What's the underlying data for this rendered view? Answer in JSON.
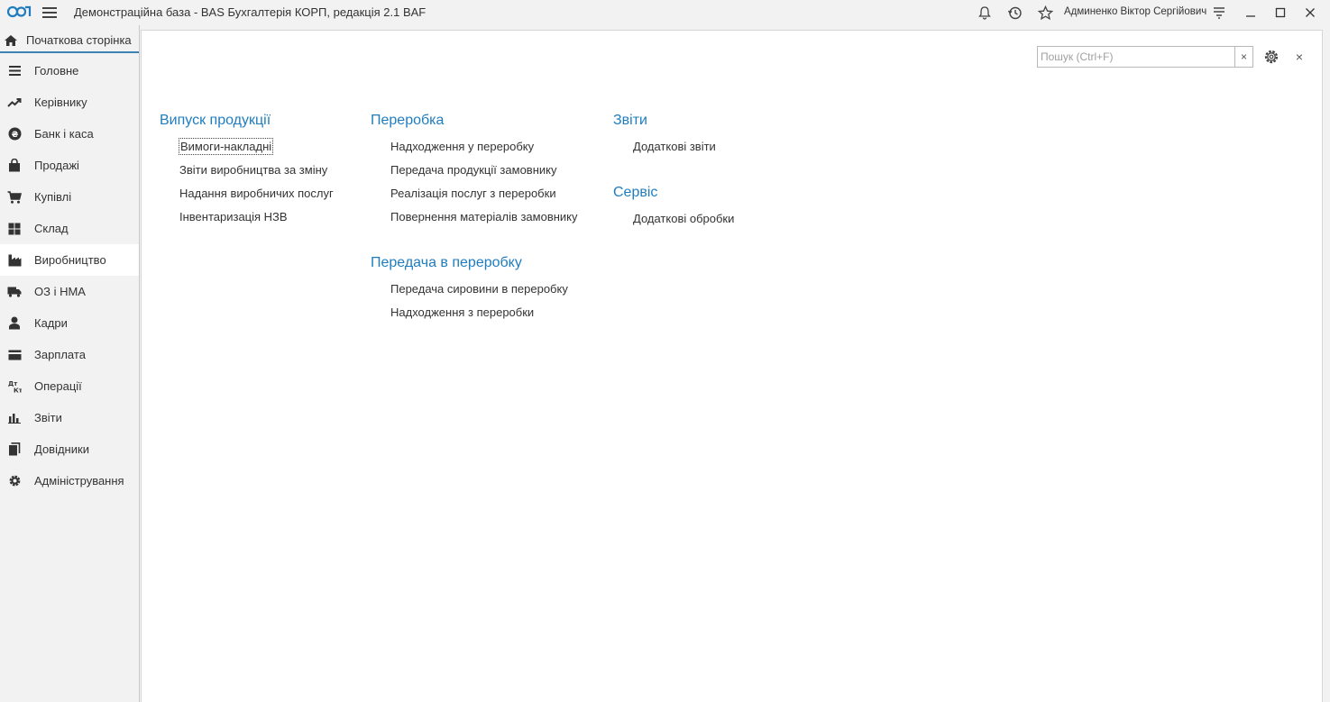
{
  "titlebar": {
    "title": "Демонстраційна база - BAS Бухгалтерія КОРП, редакція 2.1 BAF",
    "user": "Админенко Віктор Сергійович",
    "icons": [
      "bell-icon",
      "history-icon",
      "star-icon",
      "settings-lines-icon",
      "minimize-icon",
      "maximize-icon",
      "close-icon"
    ]
  },
  "colors": {
    "accent": "#1f7dbf",
    "tab_underline": "#3c83b5",
    "background": "#f2f2f2",
    "panel": "#ffffff"
  },
  "sidebar": {
    "home_label": "Початкова сторінка",
    "items": [
      {
        "label": "Головне",
        "icon": "menu-list-icon"
      },
      {
        "label": "Керівнику",
        "icon": "trend-icon"
      },
      {
        "label": "Банк і каса",
        "icon": "coin-icon"
      },
      {
        "label": "Продажі",
        "icon": "shopping-bag-icon"
      },
      {
        "label": "Купівлі",
        "icon": "cart-icon"
      },
      {
        "label": "Склад",
        "icon": "grid-icon"
      },
      {
        "label": "Виробництво",
        "icon": "factory-icon",
        "active": true
      },
      {
        "label": "ОЗ і НМА",
        "icon": "truck-icon"
      },
      {
        "label": "Кадри",
        "icon": "person-icon"
      },
      {
        "label": "Зарплата",
        "icon": "card-icon"
      },
      {
        "label": "Операції",
        "icon": "dt-kt-icon"
      },
      {
        "label": "Звіти",
        "icon": "bar-chart-icon"
      },
      {
        "label": "Довідники",
        "icon": "books-icon"
      },
      {
        "label": "Адміністрування",
        "icon": "gear-icon"
      }
    ]
  },
  "main": {
    "search": {
      "placeholder": "Пошук (Ctrl+F)",
      "value": "",
      "clear_label": "×"
    },
    "close_label": "×",
    "columns": [
      {
        "groups": [
          {
            "title": "Випуск продукції",
            "links": [
              "Вимоги-накладні",
              "Звіти виробництва за зміну",
              "Надання виробничих послуг",
              "Інвентаризація НЗВ"
            ]
          }
        ]
      },
      {
        "groups": [
          {
            "title": "Переробка",
            "links": [
              "Надходження у переробку",
              "Передача продукції замовнику",
              "Реалізація послуг з переробки",
              "Повернення матеріалів замовнику"
            ]
          },
          {
            "title": "Передача в переробку",
            "links": [
              "Передача сировини в переробку",
              "Надходження з переробки"
            ]
          }
        ]
      },
      {
        "groups": [
          {
            "title": "Звіти",
            "links": [
              "Додаткові звіти"
            ]
          },
          {
            "title": "Сервіс",
            "links": [
              "Додаткові обробки"
            ]
          }
        ]
      }
    ]
  }
}
